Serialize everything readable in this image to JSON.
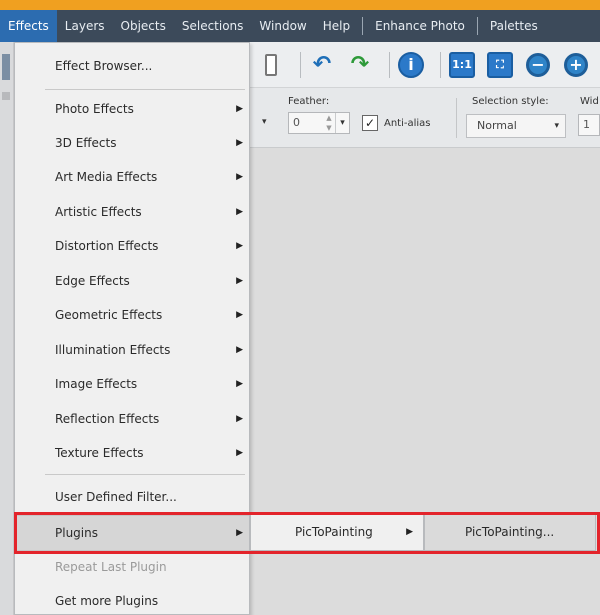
{
  "menubar": {
    "items": [
      {
        "label": "Effects",
        "active": true
      },
      {
        "label": "Layers"
      },
      {
        "label": "Objects"
      },
      {
        "label": "Selections"
      },
      {
        "label": "Window"
      },
      {
        "label": "Help"
      },
      {
        "label": "Enhance Photo"
      },
      {
        "label": "Palettes"
      }
    ]
  },
  "toolbar": {
    "icons": [
      "page-icon",
      "undo-icon",
      "redo-icon",
      "info-icon",
      "actual-size-icon",
      "fit-window-icon",
      "zoom-out-icon",
      "zoom-in-icon"
    ],
    "actual_size_glyph": "1:1"
  },
  "options": {
    "feather_label": "Feather:",
    "feather_value": "0",
    "antialias_label": "Anti-alias",
    "antialias_checked": true,
    "selection_style_label": "Selection style:",
    "selection_style_value": "Normal",
    "width_label_partial": "Wid",
    "width_value_partial": "1"
  },
  "effects_menu": {
    "items": [
      {
        "label": "Effect Browser...",
        "submenu": false
      },
      {
        "label": "Photo Effects",
        "submenu": true
      },
      {
        "label": "3D Effects",
        "submenu": true
      },
      {
        "label": "Art Media Effects",
        "submenu": true
      },
      {
        "label": "Artistic Effects",
        "submenu": true
      },
      {
        "label": "Distortion Effects",
        "submenu": true
      },
      {
        "label": "Edge Effects",
        "submenu": true
      },
      {
        "label": "Geometric Effects",
        "submenu": true
      },
      {
        "label": "Illumination Effects",
        "submenu": true
      },
      {
        "label": "Image Effects",
        "submenu": true
      },
      {
        "label": "Reflection Effects",
        "submenu": true
      },
      {
        "label": "Texture Effects",
        "submenu": true
      },
      {
        "label": "User Defined Filter...",
        "submenu": false
      },
      {
        "label": "Plugins",
        "submenu": true,
        "highlighted": true
      },
      {
        "label": "Repeat Last Plugin",
        "submenu": false,
        "disabled": true
      },
      {
        "label": "Get more Plugins",
        "submenu": false
      }
    ]
  },
  "plugins_submenu": {
    "items": [
      {
        "label": "PicToPainting",
        "submenu": true
      }
    ]
  },
  "pictopainting_submenu": {
    "items": [
      {
        "label": "PicToPainting..."
      }
    ]
  },
  "colors": {
    "menubar_bg": "#3c4a5a",
    "active_menu": "#2c6cb0",
    "highlight_box": "#e3242b"
  }
}
